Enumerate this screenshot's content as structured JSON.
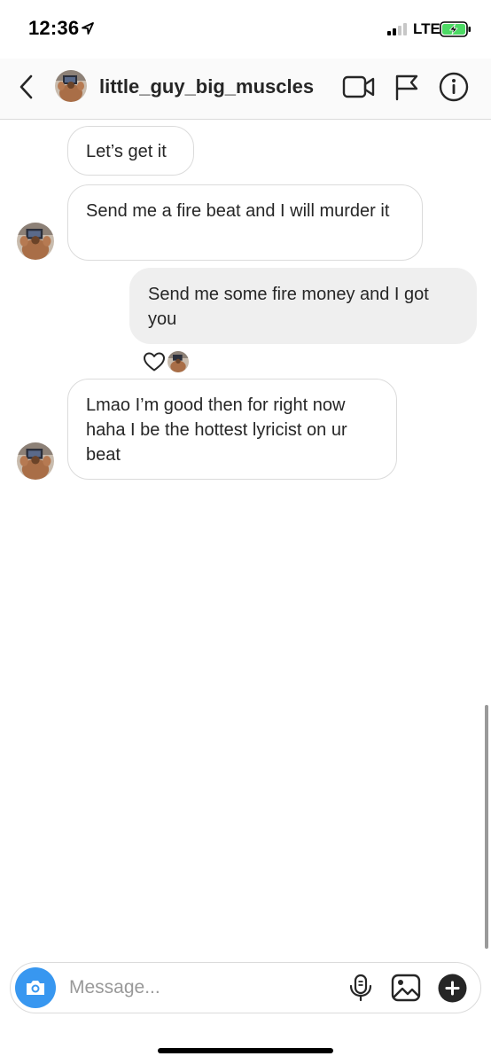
{
  "status_bar": {
    "time": "12:36",
    "network": "LTE",
    "location_icon": "location-arrow-icon",
    "signal_icon": "cellular-signal-icon",
    "battery_icon": "battery-charging-icon",
    "battery_color": "#4cd964"
  },
  "header": {
    "back_icon": "chevron-left-icon",
    "username": "little_guy_big_muscles",
    "video_icon": "video-camera-icon",
    "report_icon": "flag-icon",
    "info_icon": "info-icon"
  },
  "messages": [
    {
      "direction": "incoming",
      "text": "Let’s get it"
    },
    {
      "direction": "incoming",
      "text": "Send me a fire beat and I will murder it"
    },
    {
      "direction": "outgoing",
      "text": "Send me some fire money and I got you",
      "reaction": "heart-icon"
    },
    {
      "direction": "incoming",
      "text": "Lmao I’m good then for right now haha I be the hottest lyricist on ur beat"
    }
  ],
  "composer": {
    "placeholder": "Message...",
    "camera_icon": "camera-icon",
    "mic_icon": "microphone-icon",
    "gallery_icon": "image-icon",
    "add_icon": "plus-circle-icon",
    "accent_color": "#3897f0"
  },
  "colors": {
    "incoming_border": "#dbdbdb",
    "outgoing_bg": "#efefef",
    "text": "#262626"
  }
}
